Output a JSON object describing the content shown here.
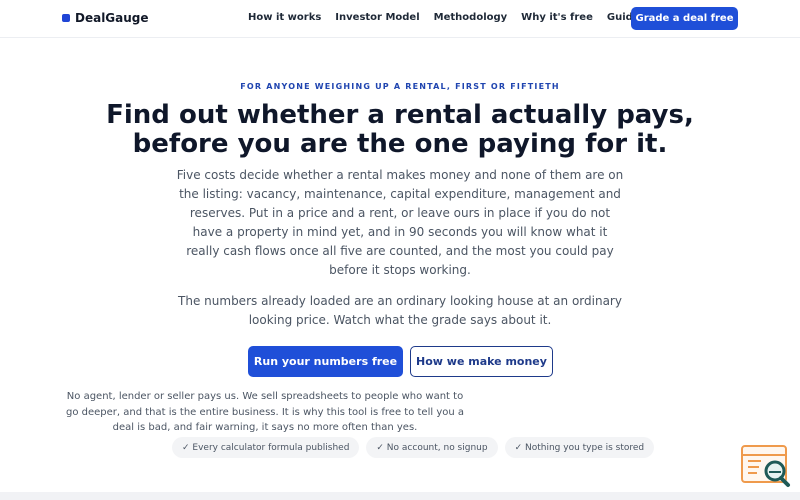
{
  "brand": {
    "name": "DealGauge",
    "accent": "#1f4fd8"
  },
  "nav": {
    "links": [
      "How it works",
      "Investor Model",
      "Methodology",
      "Why it's free",
      "Guides"
    ],
    "cta": "Grade a deal free"
  },
  "hero": {
    "eyebrow": "FOR ANYONE WEIGHING UP A RENTAL, FIRST OR FIFTIETH",
    "headline": "Find out whether a rental actually pays, before you are the one paying for it.",
    "intro": "Five costs decide whether a rental makes money and none of them are on the listing: vacancy, maintenance, capital expenditure, management and reserves. Put in a price and a rent, or leave ours in place if you do not have a property in mind yet, and in 90 seconds you will know what it really cash flows once all five are counted, and the most you could pay before it stops working.",
    "note": "The numbers already loaded are an ordinary looking house at an ordinary looking price. Watch what the grade says about it.",
    "primary_button": "Run your numbers free",
    "secondary_button": "How we make money",
    "disclosure": "No agent, lender or seller pays us. We sell spreadsheets to people who want to go deeper, and that is the entire business. It is why this tool is free to tell you a deal is bad, and fair warning, it says no more often than yes.",
    "chips": [
      "✓ Every calculator formula published",
      "✓ No account, no signup",
      "✓ Nothing you type is stored"
    ]
  },
  "icons": {
    "corner_badge": "spreadsheet-magnifier-icon"
  }
}
